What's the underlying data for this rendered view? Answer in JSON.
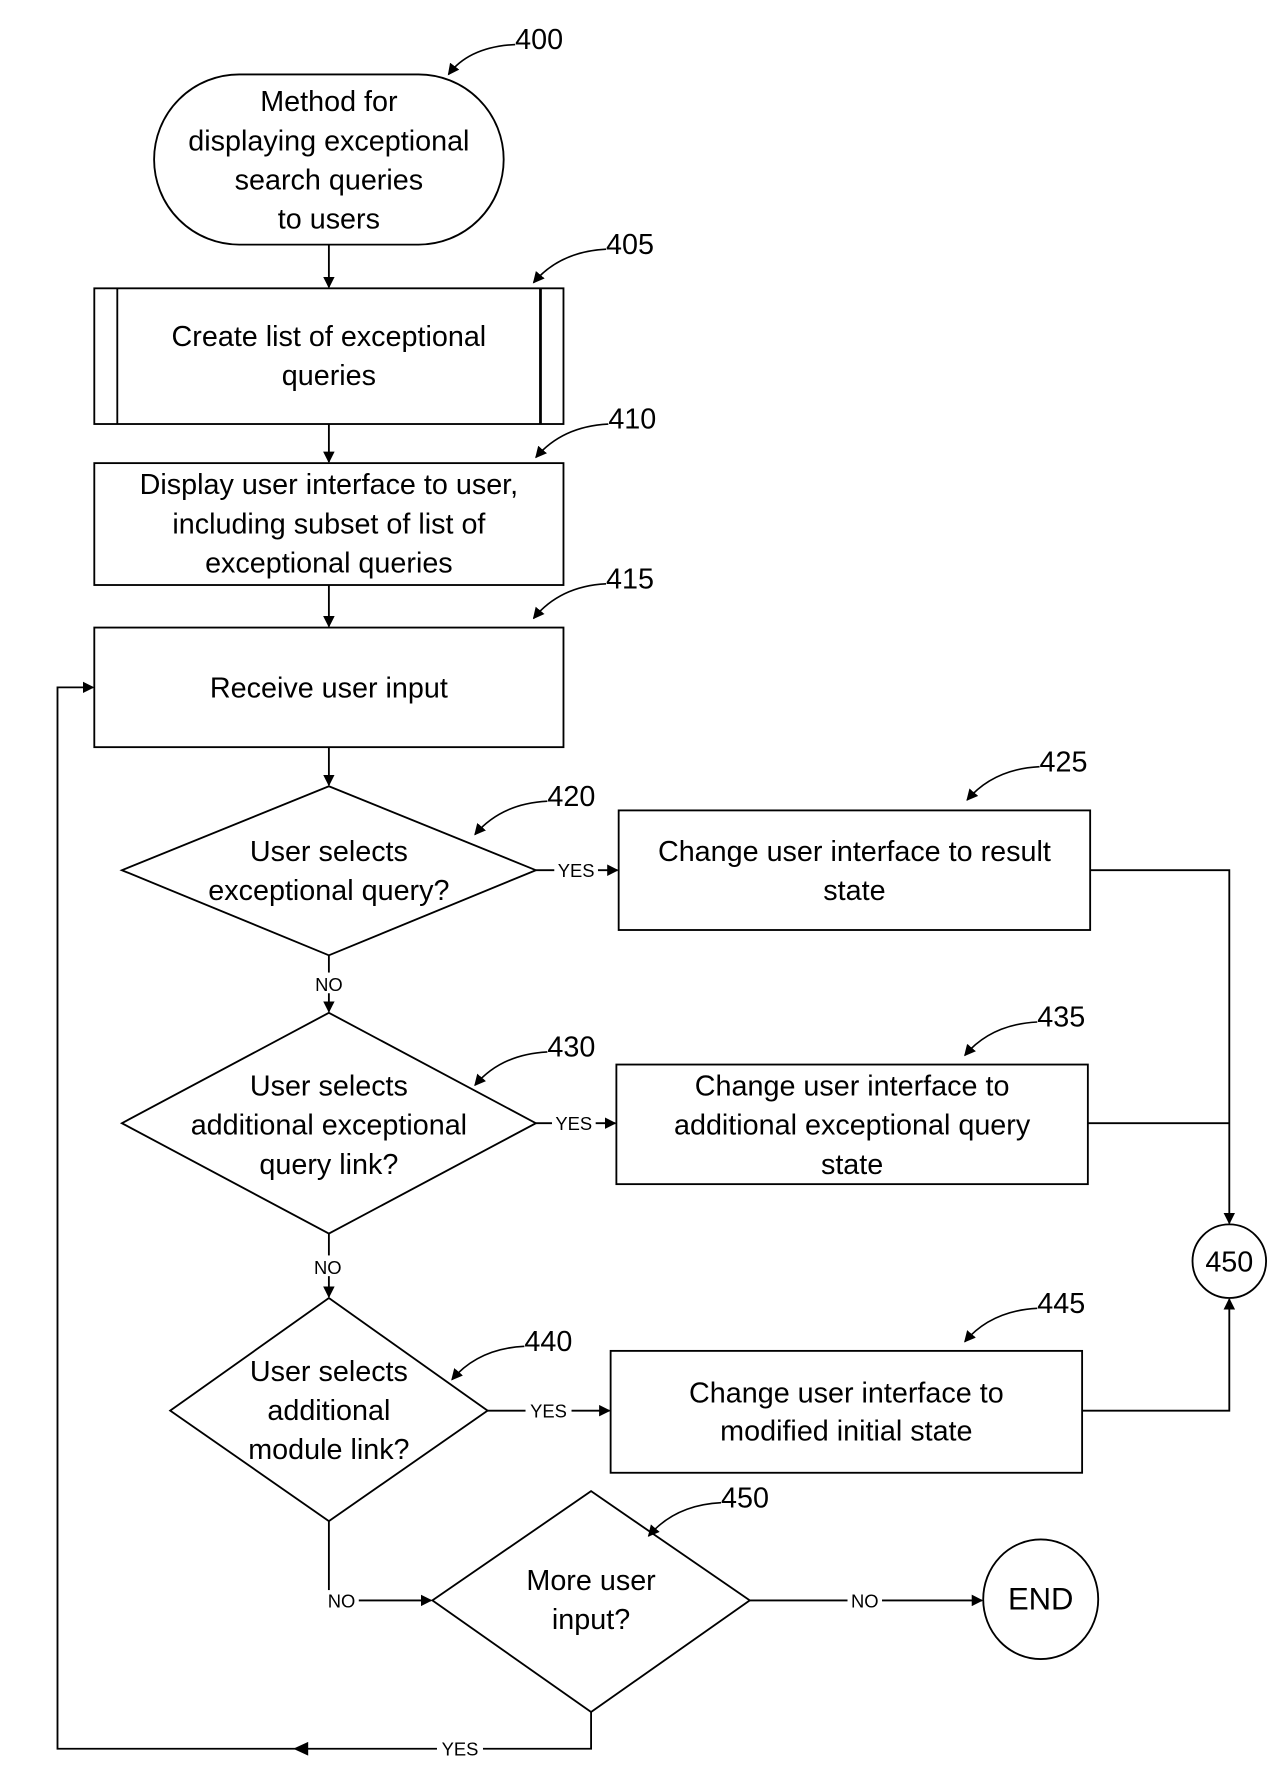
{
  "figure": {
    "nodes": {
      "start": {
        "ref": "400",
        "type": "terminator",
        "lines": [
          "Method for",
          "displaying exceptional",
          "search queries",
          "to users"
        ]
      },
      "create_list": {
        "ref": "405",
        "type": "predefined-process",
        "lines": [
          "Create list of exceptional",
          "queries"
        ]
      },
      "display_ui": {
        "ref": "410",
        "type": "process",
        "lines": [
          "Display user interface to user,",
          "including subset of list of",
          "exceptional queries"
        ]
      },
      "receive_input": {
        "ref": "415",
        "type": "process",
        "lines": [
          "Receive user input"
        ]
      },
      "decision_query": {
        "ref": "420",
        "type": "decision",
        "lines": [
          "User selects",
          "exceptional query?"
        ]
      },
      "result_state": {
        "ref": "425",
        "type": "process",
        "lines": [
          "Change user interface to result",
          "state"
        ]
      },
      "decision_additional_query": {
        "ref": "430",
        "type": "decision",
        "lines": [
          "User selects",
          "additional exceptional",
          "query link?"
        ]
      },
      "additional_query_state": {
        "ref": "435",
        "type": "process",
        "lines": [
          "Change user interface to",
          "additional exceptional query",
          "state"
        ]
      },
      "decision_module": {
        "ref": "440",
        "type": "decision",
        "lines": [
          "User selects",
          "additional",
          "module  link?"
        ]
      },
      "modified_initial_state": {
        "ref": "445",
        "type": "process",
        "lines": [
          "Change user interface to",
          "modified initial state"
        ]
      },
      "decision_more_input": {
        "ref": "450",
        "type": "decision",
        "lines": [
          "More user",
          "input?"
        ]
      },
      "connector": {
        "type": "connector",
        "lines": [
          "450"
        ]
      },
      "end": {
        "type": "terminator",
        "lines": [
          "END"
        ]
      }
    },
    "edge_labels": {
      "yes": "YES",
      "no": "NO"
    }
  }
}
